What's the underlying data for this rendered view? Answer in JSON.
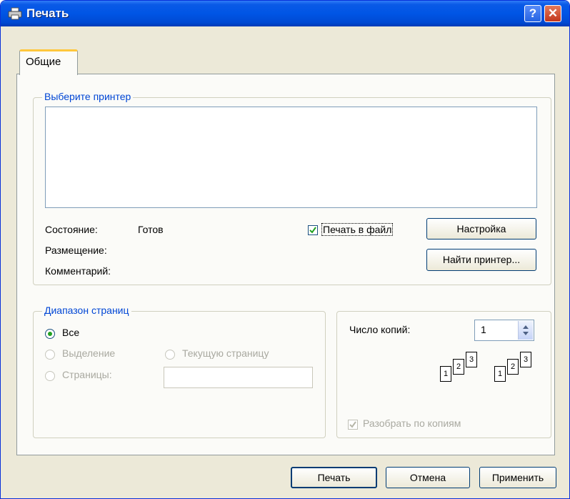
{
  "window": {
    "title": "Печать",
    "help_glyph": "?",
    "close_glyph": "✕",
    "icon": "printer-icon"
  },
  "tabs": [
    {
      "label": "Общие",
      "selected": true
    }
  ],
  "printer_group": {
    "label": "Выберите принтер",
    "status_label": "Состояние:",
    "status_value": "Готов",
    "location_label": "Размещение:",
    "comment_label": "Комментарий:",
    "print_to_file": {
      "label": "Печать в файл",
      "checked": true
    },
    "setup_button": "Настройка",
    "find_button": "Найти принтер..."
  },
  "page_range": {
    "label": "Диапазон страниц",
    "all": {
      "label": "Все",
      "selected": true
    },
    "selection": {
      "label": "Выделение"
    },
    "current": {
      "label": "Текущую страницу"
    },
    "pages": {
      "label": "Страницы:",
      "value": ""
    }
  },
  "copies": {
    "label": "Число копий:",
    "value": "1",
    "collate": {
      "label": "Разобрать по копиям",
      "checked": true,
      "enabled": false
    },
    "page_numbers": [
      "1",
      "2",
      "3"
    ]
  },
  "buttons": {
    "print": "Печать",
    "cancel": "Отмена",
    "apply": "Применить"
  },
  "colors": {
    "title_bar": "#0055e5",
    "group_label": "#0046d5",
    "dialog_bg": "#ece9d8"
  }
}
